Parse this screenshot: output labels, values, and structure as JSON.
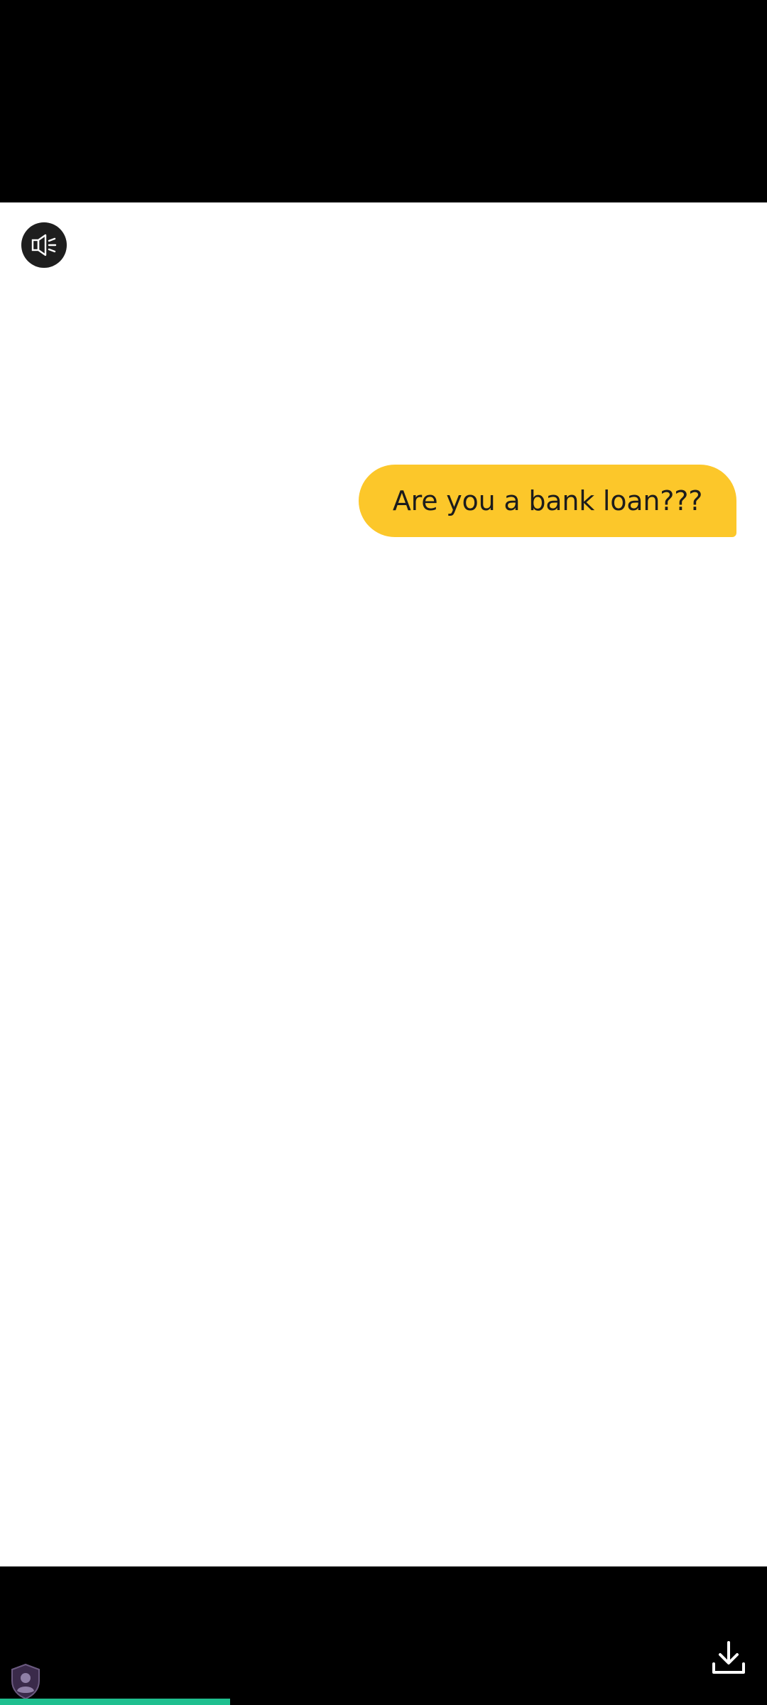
{
  "message": {
    "text": "Are you a bank loan???"
  },
  "controls": {
    "mute_icon": "speaker-muted-icon",
    "download_icon": "download-icon",
    "shield_icon": "shield-user-icon"
  },
  "playback": {
    "progress_fraction": 0.3
  },
  "colors": {
    "bubble": "#fcc72a",
    "progress": "#1fbf8f",
    "background": "#ffffff"
  }
}
